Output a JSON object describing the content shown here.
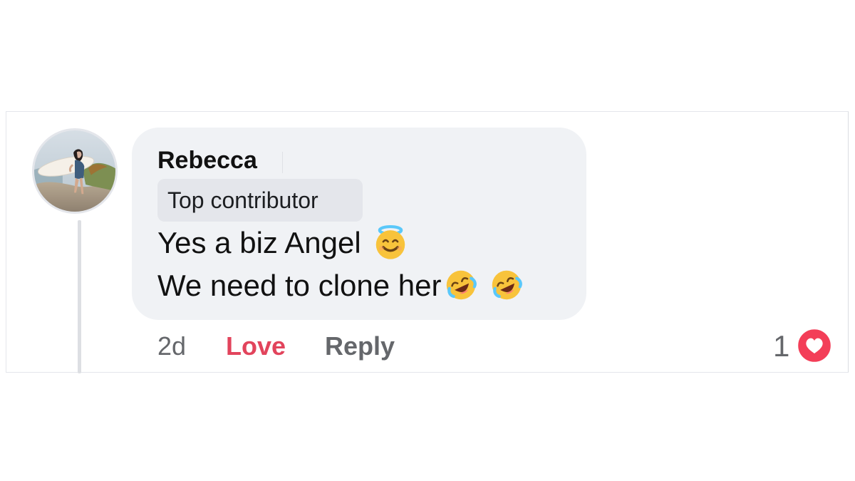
{
  "comment": {
    "author": "Rebecca",
    "badge": "Top contributor",
    "text_line1": "Yes a biz Angel",
    "text_line2": "We need to clone her",
    "emoji_line1": [
      "smiling-face-with-halo"
    ],
    "emoji_line2": [
      "rolling-on-floor-laughing",
      "rolling-on-floor-laughing"
    ]
  },
  "actions": {
    "time": "2d",
    "love_label": "Love",
    "reply_label": "Reply"
  },
  "reactions": {
    "count": "1",
    "type": "heart"
  },
  "colors": {
    "bubble_bg": "#f0f2f5",
    "badge_bg": "#e4e6eb",
    "love_accent": "#e2445c",
    "muted_text": "#65676b",
    "heart_red": "#f33e58"
  }
}
